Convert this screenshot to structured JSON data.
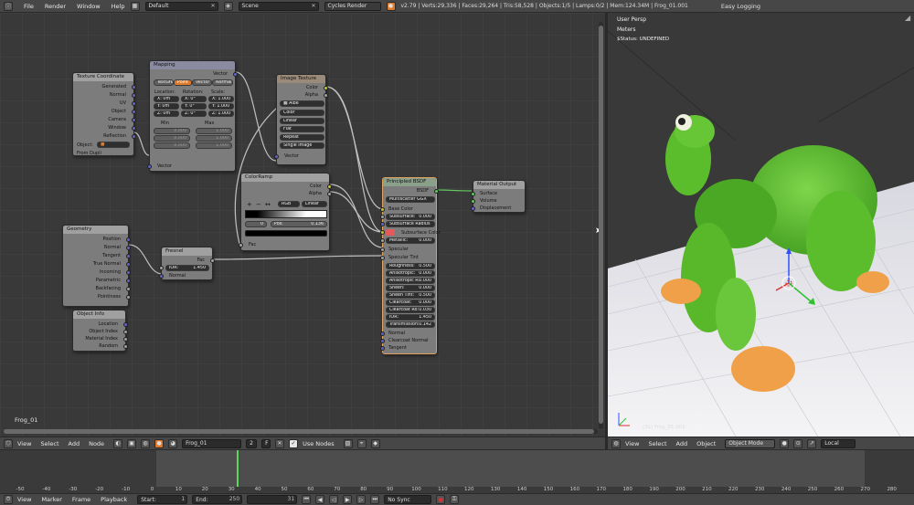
{
  "topbar": {
    "menus": [
      "File",
      "Render",
      "Window",
      "Help"
    ],
    "layout": "Default",
    "scene": "Scene",
    "engine": "Cycles Render",
    "stats": "v2.79 | Verts:29,336 | Faces:29,264 | Tris:58,528 | Objects:1/5 | Lamps:0/2 | Mem:124.34M | Frog_01.001",
    "easy_logging": "Easy Logging"
  },
  "nodes": {
    "tex_coord": {
      "title": "Texture Coordinate",
      "outputs": [
        "Generated",
        "Normal",
        "UV",
        "Object",
        "Camera",
        "Window",
        "Reflection"
      ],
      "object_label": "Object:",
      "from_dupli": "From Dupli"
    },
    "mapping": {
      "title": "Mapping",
      "out": "Vector",
      "modes": [
        "Texture",
        "Point",
        "Vector",
        "Normal"
      ],
      "col_location": "Location:",
      "col_rotation": "Rotation:",
      "col_scale": "Scale:",
      "loc": [
        "X: 0m",
        "Y: 0m",
        "Z: 0m"
      ],
      "rot": [
        "X: 0°",
        "Y: 0°",
        "Z: 0°"
      ],
      "scale": [
        "X: 1.000",
        "Y: 1.000",
        "Z: 1.000"
      ],
      "min_label": "Min",
      "max_label": "Max",
      "min": [
        "0.000",
        "0.000",
        "0.000"
      ],
      "max": [
        "1.000",
        "1.000",
        "1.000"
      ],
      "in": "Vector"
    },
    "image_texture": {
      "title": "Image Texture",
      "out_color": "Color",
      "out_alpha": "Alpha",
      "image": "Albe",
      "options": [
        "Color",
        "Linear",
        "Flat",
        "Repeat",
        "Single Image"
      ],
      "in": "Vector"
    },
    "color_ramp": {
      "title": "ColorRamp",
      "out_color": "Color",
      "out_alpha": "Alpha",
      "plus": "+",
      "minus": "−",
      "flip": "↔",
      "mode": "RGB",
      "interp": "Linear",
      "index": "0",
      "pos": "Pos:",
      "pos_val": "0.136",
      "in": "Fac"
    },
    "geometry": {
      "title": "Geometry",
      "outputs": [
        "Position",
        "Normal",
        "Tangent",
        "True Normal",
        "Incoming",
        "Parametric",
        "Backfacing",
        "Pointiness"
      ]
    },
    "fresnel": {
      "title": "Fresnel",
      "out": "Fac",
      "ior_label": "IOR:",
      "ior": "1.450",
      "in": "Normal"
    },
    "object_info": {
      "title": "Object Info",
      "outputs": [
        "Location",
        "Object Index",
        "Material Index",
        "Random"
      ]
    },
    "principled": {
      "title": "Principled BSDF",
      "out": "BSDF",
      "dist": "Multiscatter GGX",
      "base_color": "Base Color",
      "subsurface": "Subsurface:",
      "subsurface_val": "0.000",
      "subsurface_radius": "Subsurface Radius",
      "subsurface_color": "Subsurface Color",
      "metallic": "Metallic:",
      "metallic_val": "0.000",
      "specular": "Specular",
      "specular_tint": "Specular Tint",
      "params": [
        {
          "label": "Roughness:",
          "val": "0.500"
        },
        {
          "label": "Anisotropic:",
          "val": "0.000"
        },
        {
          "label": "Anisotropic R:",
          "val": "0.000"
        },
        {
          "label": "Sheen:",
          "val": "0.000"
        },
        {
          "label": "Sheen Tint:",
          "val": "0.500"
        },
        {
          "label": "Clearcoat:",
          "val": "0.000"
        },
        {
          "label": "Clearcoat Ro:",
          "val": "0.030"
        },
        {
          "label": "IOR:",
          "val": "1.450"
        },
        {
          "label": "Transmission:",
          "val": "0.142"
        }
      ],
      "normal": "Normal",
      "clearcoat_normal": "Clearcoat Normal",
      "tangent": "Tangent"
    },
    "material_output": {
      "title": "Material Output",
      "inputs": [
        "Surface",
        "Volume",
        "Displacement"
      ]
    }
  },
  "node_editor": {
    "object_name": "Frog_01",
    "menus": [
      "View",
      "Select",
      "Add",
      "Node"
    ],
    "material": "Frog_01",
    "users": "2",
    "fake": "F",
    "use_nodes": "Use Nodes"
  },
  "viewport": {
    "view_name": "User Persp",
    "units": "Meters",
    "status": "$Status: UNDEFINED",
    "object_label": "(31) Frog_01.001",
    "menus": [
      "View",
      "Select",
      "Add",
      "Object"
    ],
    "mode": "Object Mode",
    "orientation": "Local"
  },
  "timeline": {
    "ruler": [
      "-50",
      "-40",
      "-30",
      "-20",
      "-10",
      "0",
      "10",
      "20",
      "30",
      "40",
      "50",
      "60",
      "70",
      "80",
      "90",
      "100",
      "110",
      "120",
      "130",
      "140",
      "150",
      "160",
      "170",
      "180",
      "190",
      "200",
      "210",
      "220",
      "230",
      "240",
      "250",
      "260",
      "270",
      "280"
    ],
    "current_frame": 31,
    "menus": [
      "View",
      "Marker",
      "Frame",
      "Playback"
    ],
    "start_label": "Start:",
    "start": "1",
    "end_label": "End:",
    "end": "250",
    "current": "31",
    "sync": "No Sync"
  },
  "colors": {
    "frog_green": "#5cbd2c",
    "frog_orange": "#f0a048",
    "accent_orange": "#e07a2a",
    "cursor_green": "#5cd65c"
  }
}
